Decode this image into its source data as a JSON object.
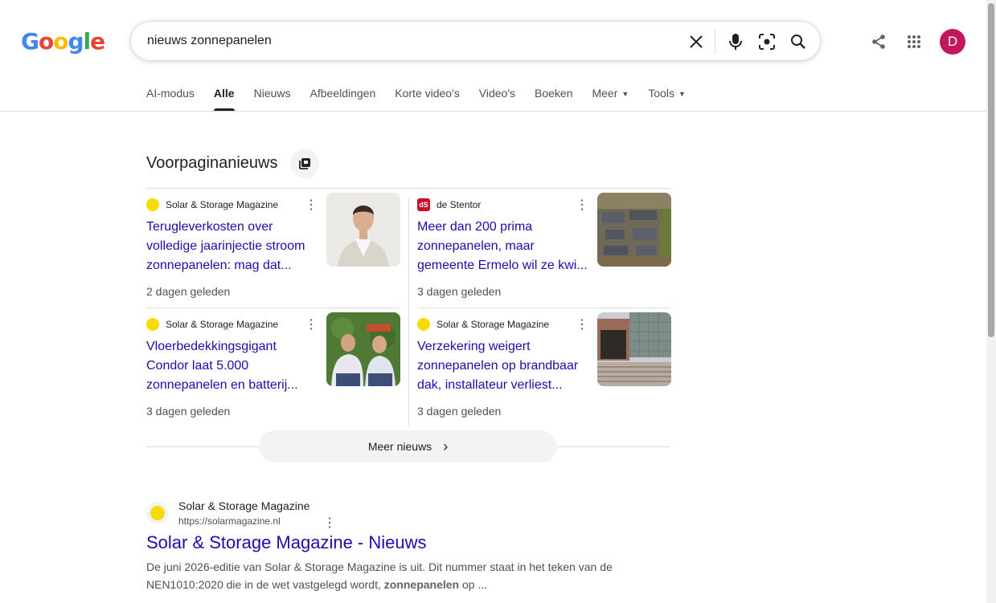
{
  "logo": {
    "letters": [
      "G",
      "o",
      "o",
      "g",
      "l",
      "e"
    ],
    "colors": [
      "#4285F4",
      "#EA4335",
      "#FBBC05",
      "#4285F4",
      "#34A853",
      "#EA4335"
    ]
  },
  "search": {
    "query": "nieuws zonnepanelen"
  },
  "header": {
    "avatar_letter": "D",
    "avatar_color": "#c2185b"
  },
  "tabs": [
    {
      "label": "AI-modus"
    },
    {
      "label": "Alle",
      "active": true
    },
    {
      "label": "Nieuws"
    },
    {
      "label": "Afbeeldingen"
    },
    {
      "label": "Korte video's"
    },
    {
      "label": "Video's"
    },
    {
      "label": "Boeken"
    },
    {
      "label": "Meer"
    },
    {
      "label": "Tools"
    }
  ],
  "news": {
    "section_title": "Voorpaginanieuws",
    "cards": [
      {
        "source": "Solar & Storage Magazine",
        "title_lines": [
          "Terugleverkosten over",
          "volledige jaarinjectie stroom",
          "zonnepanelen: mag dat..."
        ],
        "time": "2 dagen geleden"
      },
      {
        "source": "de Stentor",
        "source_logo": "dS",
        "title_lines": [
          "Meer dan 200 prima",
          "zonnepanelen, maar",
          "gemeente Ermelo wil ze kwi..."
        ],
        "time": "3 dagen geleden"
      },
      {
        "source": "Solar & Storage Magazine",
        "title_lines": [
          "Vloerbedekkingsgigant",
          "Condor laat 5.000",
          "zonnepanelen en batterij..."
        ],
        "time": "3 dagen geleden"
      },
      {
        "source": "Solar & Storage Magazine",
        "title_lines": [
          "Verzekering weigert",
          "zonnepanelen op brandbaar",
          "dak, installateur verliest..."
        ],
        "time": "3 dagen geleden"
      }
    ],
    "more_label": "Meer nieuws",
    "more_chevron": "›"
  },
  "result": {
    "site": "Solar & Storage Magazine",
    "url": "https://solarmagazine.nl",
    "title": "Solar & Storage Magazine - Nieuws",
    "snippet_line1": "De juni 2026-editie van Solar & Storage Magazine is uit. Dit nummer staat in het teken van de",
    "snippet_line2_pre": "NEN1010:2020 die in de wet vastgelegd wordt, ",
    "snippet_line2_bold": "zonnepanelen",
    "snippet_line2_post": " op ..."
  }
}
